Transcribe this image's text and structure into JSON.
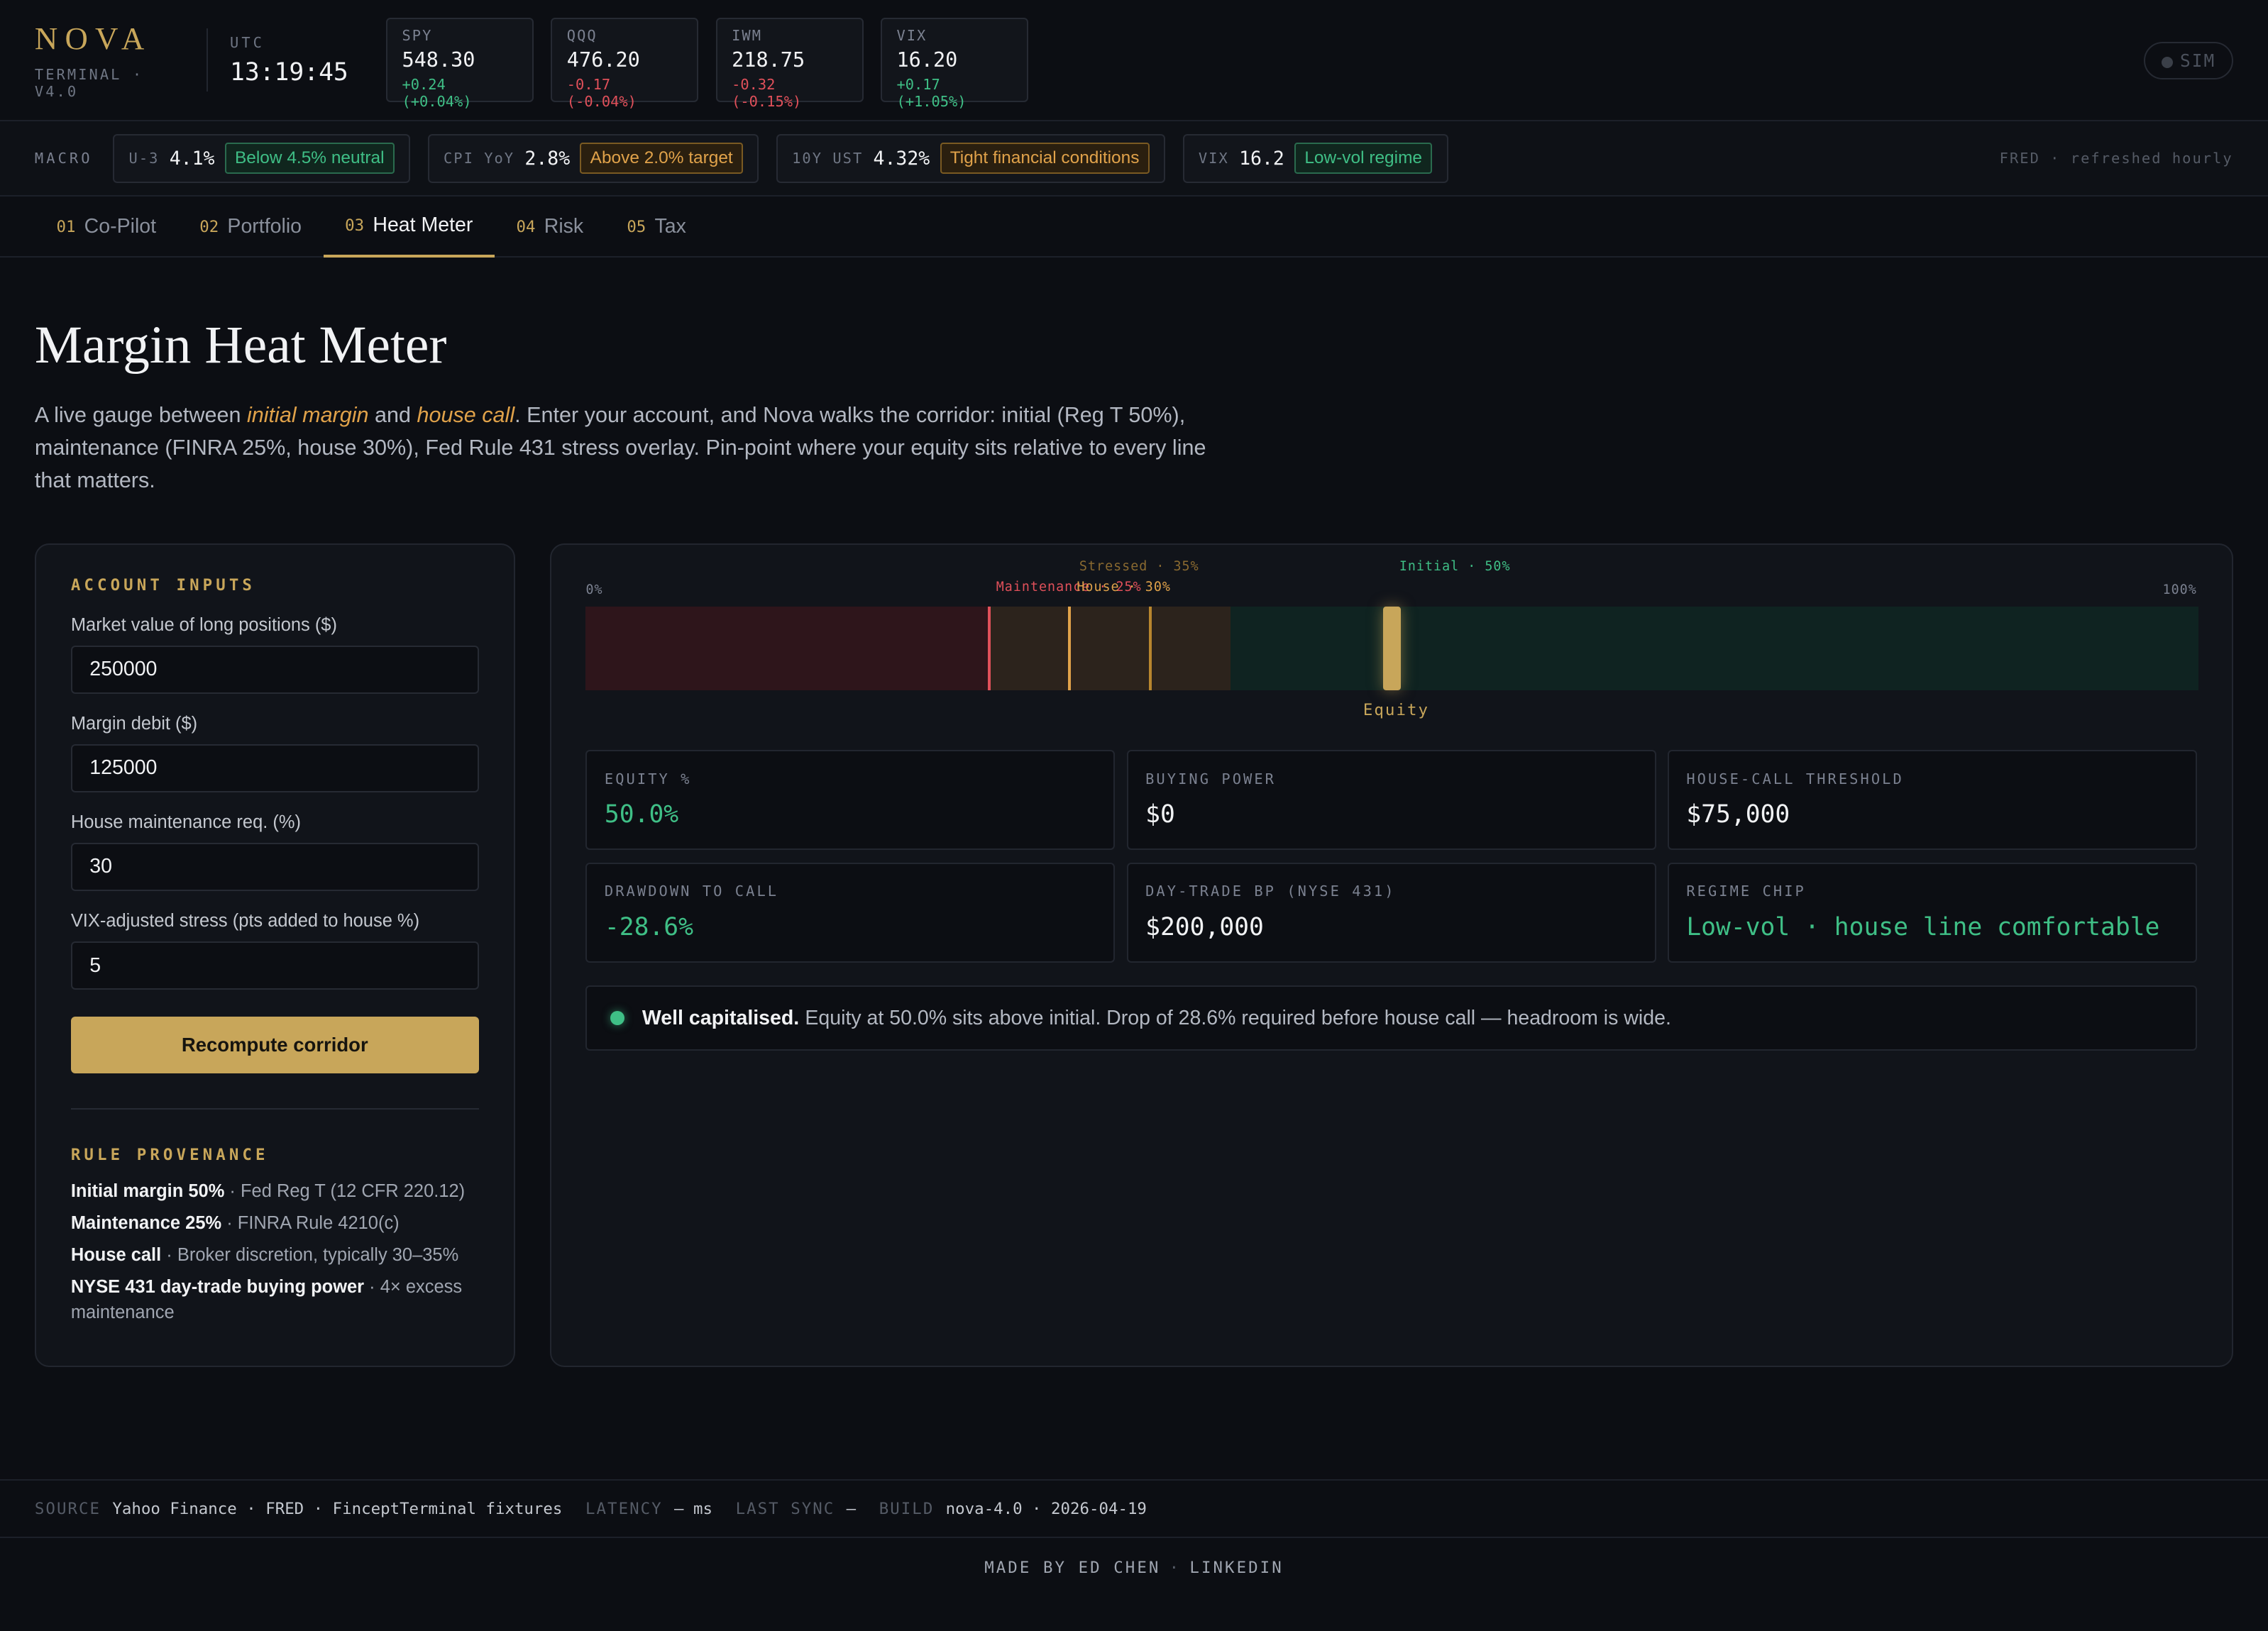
{
  "brand": {
    "name": "NOVA",
    "sub": "TERMINAL · V4.0"
  },
  "clock": {
    "label": "UTC",
    "time": "13:19:45"
  },
  "tickers": [
    {
      "sym": "SPY",
      "price": "548.30",
      "change": "+0.24 (+0.04%)",
      "dir": "up"
    },
    {
      "sym": "QQQ",
      "price": "476.20",
      "change": "-0.17 (-0.04%)",
      "dir": "down"
    },
    {
      "sym": "IWM",
      "price": "218.75",
      "change": "-0.32 (-0.15%)",
      "dir": "down"
    },
    {
      "sym": "VIX",
      "price": "16.20",
      "change": "+0.17 (+1.05%)",
      "dir": "up"
    }
  ],
  "sim_label": "SIM",
  "macro": {
    "label": "MACRO",
    "items": [
      {
        "key": "U-3",
        "value": "4.1%",
        "tag": "Below 4.5% neutral",
        "tone": "green"
      },
      {
        "key": "CPI YoY",
        "value": "2.8%",
        "tag": "Above 2.0% target",
        "tone": "amber"
      },
      {
        "key": "10Y UST",
        "value": "4.32%",
        "tag": "Tight financial conditions",
        "tone": "amber"
      },
      {
        "key": "VIX",
        "value": "16.2",
        "tag": "Low-vol regime",
        "tone": "green"
      }
    ],
    "source": "FRED · refreshed hourly"
  },
  "tabs": [
    {
      "num": "01",
      "label": "Co-Pilot"
    },
    {
      "num": "02",
      "label": "Portfolio"
    },
    {
      "num": "03",
      "label": "Heat Meter",
      "active": true
    },
    {
      "num": "04",
      "label": "Risk"
    },
    {
      "num": "05",
      "label": "Tax"
    }
  ],
  "page": {
    "title": "Margin Heat Meter",
    "intro_pre": "A live gauge between ",
    "intro_em1": "initial margin",
    "intro_mid": " and ",
    "intro_em2": "house call",
    "intro_post": ". Enter your account, and Nova walks the corridor: initial (Reg T 50%), maintenance (FINRA 25%, house 30%), Fed Rule 431 stress overlay. Pin-point where your equity sits relative to every line that matters."
  },
  "inputs": {
    "title": "ACCOUNT INPUTS",
    "fields": [
      {
        "label": "Market value of long positions ($)",
        "value": "250000"
      },
      {
        "label": "Margin debit ($)",
        "value": "125000"
      },
      {
        "label": "House maintenance req. (%)",
        "value": "30"
      },
      {
        "label": "VIX-adjusted stress (pts added to house %)",
        "value": "5"
      }
    ],
    "button": "Recompute corridor"
  },
  "provenance": {
    "title": "RULE PROVENANCE",
    "rules": [
      {
        "bold": "Initial margin 50%",
        "text": " · Fed Reg T (12 CFR 220.12)"
      },
      {
        "bold": "Maintenance 25%",
        "text": " · FINRA Rule 4210(c)"
      },
      {
        "bold": "House call",
        "text": " · Broker discretion, typically 30–35%"
      },
      {
        "bold": "NYSE 431 day-trade buying power",
        "text": " · 4× excess maintenance"
      }
    ]
  },
  "gauge": {
    "min_label": "0%",
    "max_label": "100%",
    "maintenance": {
      "label": "Maintenance · 25%",
      "pct": 25
    },
    "house": {
      "label": "House · 30%",
      "pct": 30
    },
    "stressed": {
      "label": "Stressed · 35%",
      "pct": 35
    },
    "initial": {
      "label": "Initial · 50%",
      "pct": 50
    },
    "equity": {
      "label": "Equity",
      "pct": 50
    },
    "colors": {
      "red": "#e0505a",
      "amber": "#e0a24a",
      "green": "#3fbf86",
      "gold": "#c8a65a"
    }
  },
  "stats": [
    {
      "label": "EQUITY %",
      "value": "50.0%",
      "tone": "green"
    },
    {
      "label": "BUYING POWER",
      "value": "$0",
      "tone": ""
    },
    {
      "label": "HOUSE-CALL THRESHOLD",
      "value": "$75,000",
      "tone": ""
    },
    {
      "label": "DRAWDOWN TO CALL",
      "value": "-28.6%",
      "tone": "green"
    },
    {
      "label": "DAY-TRADE BP (NYSE 431)",
      "value": "$200,000",
      "tone": ""
    },
    {
      "label": "REGIME CHIP",
      "value": "Low-vol · house line comfortable",
      "tone": "green"
    }
  ],
  "status": {
    "bold": "Well capitalised.",
    "text": "Equity at 50.0% sits above initial. Drop of 28.6% required before house call — headroom is wide."
  },
  "footer": {
    "source_k": "SOURCE",
    "source_v": "Yahoo Finance · FRED · FinceptTerminal fixtures",
    "latency_k": "LATENCY",
    "latency_v": "— ms",
    "sync_k": "LAST SYNC",
    "sync_v": "—",
    "build_k": "BUILD",
    "build_v": "nova-4.0 · 2026-04-19"
  },
  "credit": {
    "made": "MADE BY ED CHEN",
    "link": "LINKEDIN"
  }
}
